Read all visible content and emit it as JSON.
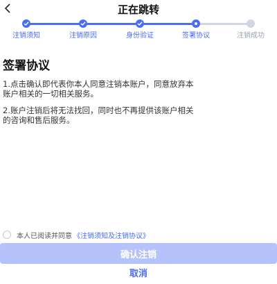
{
  "header": {
    "title": "正在跳转",
    "back_icon": "chevron-left-icon"
  },
  "steps": [
    {
      "label": "注销须知",
      "status": "done"
    },
    {
      "label": "注销原因",
      "status": "done"
    },
    {
      "label": "身份验证",
      "status": "done"
    },
    {
      "label": "签署协议",
      "status": "current"
    },
    {
      "label": "注销成功",
      "status": "pending"
    }
  ],
  "content": {
    "title": "签署协议",
    "clauses": [
      {
        "line1": "1.点击确认即代表你本人同意注销本账户，同意放弃本",
        "line2": "账户相关的一切相关服务。"
      },
      {
        "line1": "2.账户注销后将无法找回，同时也不再提供该账户相关",
        "line2": "的咨询和售后服务。"
      }
    ]
  },
  "agreement": {
    "prefix": "本人已阅读并同意",
    "link": "《注销须知及注销协议》",
    "checked": false
  },
  "actions": {
    "confirm_label": "确认注销",
    "cancel_label": "取消"
  },
  "colors": {
    "accent": "#4a6cf7",
    "inactive": "#d0d6e6",
    "confirm_disabled": "#b6c3fa"
  }
}
